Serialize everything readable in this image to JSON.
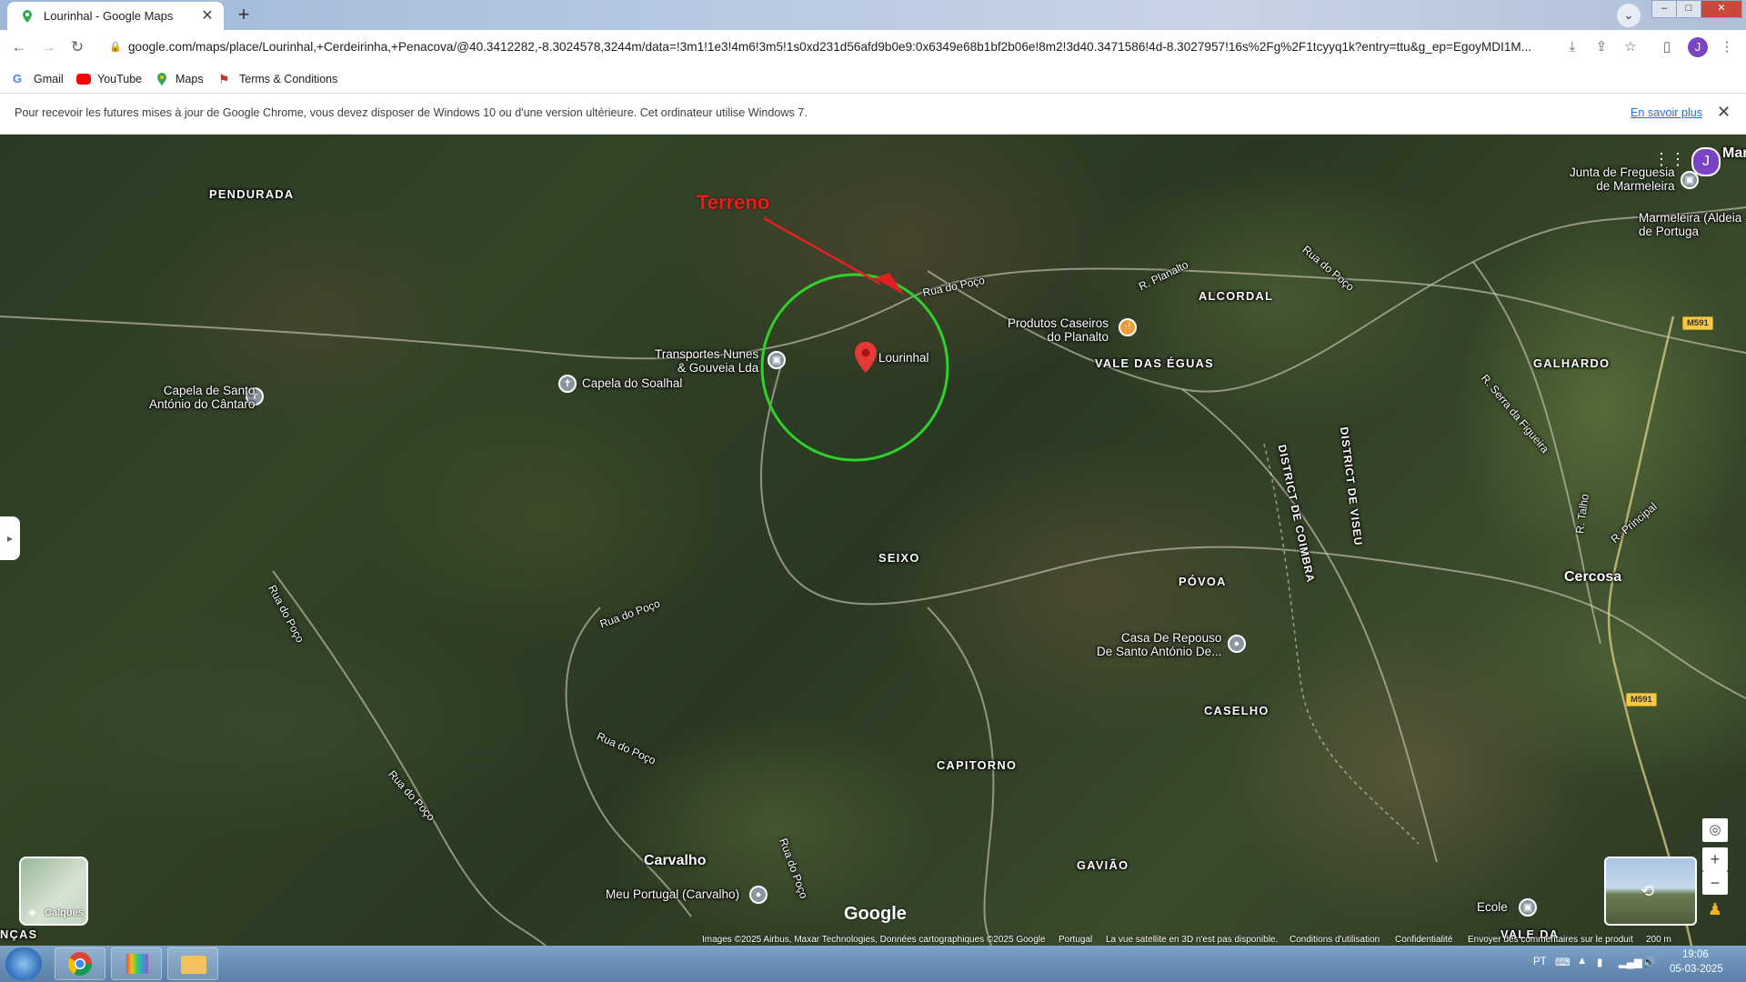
{
  "browser": {
    "tab_title": "Lourinhal - Google Maps",
    "url": "google.com/maps/place/Lourinhal,+Cerdeirinha,+Penacova/@40.3412282,-8.3024578,3244m/data=!3m1!1e3!4m6!3m5!1s0xd231d56afd9b0e9:0x6349e68b1bf2b06e!8m2!3d40.3471586!4d-8.3027957!16s%2Fg%2F1tcyyq1k?entry=ttu&g_ep=EgoyMDI1M...",
    "profile_initial": "J"
  },
  "bookmarks": [
    {
      "label": "Gmail",
      "icon": "gmail-icon"
    },
    {
      "label": "YouTube",
      "icon": "youtube-icon"
    },
    {
      "label": "Maps",
      "icon": "maps-icon"
    },
    {
      "label": "Terms & Conditions",
      "icon": "terms-icon"
    }
  ],
  "infobar": {
    "text": "Pour recevoir les futures mises à jour de Google Chrome, vous devez disposer de Windows 10 ou d'une version ultérieure. Cet ordinateur utilise Windows 7.",
    "link": "En savoir plus"
  },
  "map": {
    "annotation": "Terreno",
    "selected_place": "Lourinhal",
    "places": {
      "pendurada": "PENDURADA",
      "alcordal": "ALCORDAL",
      "vale_das_eguas": "VALE DAS ÉGUAS",
      "galhardo": "GALHARDO",
      "seixo": "SEIXO",
      "povoa": "PÓVOA",
      "cercosa": "Cercosa",
      "caselho": "CASELHO",
      "capitorno": "CAPITORNO",
      "gaviao": "GAVIÃO",
      "carvalho": "Carvalho",
      "marmeleira": "Mar",
      "nças": "NÇAS",
      "vale_da": "VALE DA"
    },
    "pois": {
      "capela_santo_line1": "Capela de Santo",
      "capela_santo_line2": "António do Cântaro",
      "capela_soalhal": "Capela do Soalhal",
      "transportes_line1": "Transportes Nunes",
      "transportes_line2": "& Gouveia Lda",
      "produtos_line1": "Produtos Caseiros",
      "produtos_line2": "do Planalto",
      "junta_line1": "Junta de Freguesia",
      "junta_line2": "de Marmeleira",
      "marmeleira_line1": "Marmeleira (Aldeia",
      "marmeleira_line2": "de Portuga",
      "casa_line1": "Casa De Repouso",
      "casa_line2": "De Santo António De...",
      "meu_portugal": "Meu Portugal (Carvalho)",
      "ecole": "Ecole"
    },
    "roads": {
      "rua_do_poco": "Rua do Poço",
      "r_planalto": "R. Planalto",
      "r_serra_figueira": "R. Serra da Figueira",
      "r_talho": "R. Talho",
      "r_principal": "R. Principal",
      "district_coimbra": "DISTRICT DE COIMBRA",
      "district_viseu": "DISTRICT DE VISEU",
      "m591": "M591"
    },
    "layers_label": "Calques",
    "google": "Google",
    "attribution": {
      "images": "Images ©2025 Airbus, Maxar Technologies, Données cartographiques ©2025 Google",
      "country": "Portugal",
      "three_d": "La vue satellite en 3D n'est pas disponible.",
      "terms": "Conditions d'utilisation",
      "privacy": "Confidentialité",
      "feedback": "Envoyer des commentaires sur le produit",
      "scale": "200 m"
    }
  },
  "taskbar": {
    "lang": "PT",
    "time": "19:06",
    "date": "05-03-2025"
  },
  "colors": {
    "annotation_red": "#e41f1f",
    "circle_green": "#2fd12a",
    "pin_red": "#e53935"
  }
}
